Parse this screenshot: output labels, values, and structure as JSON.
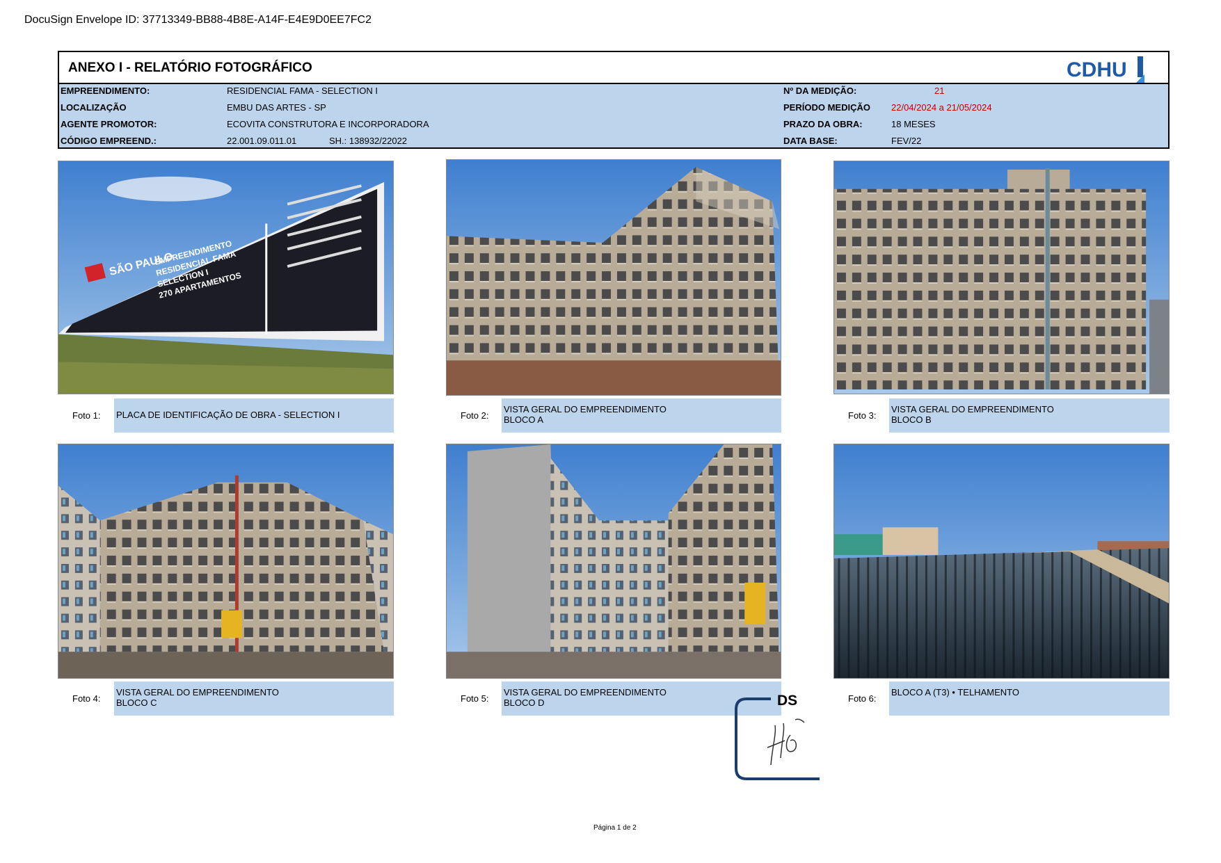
{
  "envelope_id": "DocuSign Envelope ID: 37713349-BB88-4B8E-A14F-E4E9D0EE7FC2",
  "header": {
    "title": "ANEXO I - RELATÓRIO FOTOGRÁFICO",
    "logo_text": "CDHU",
    "left_fields": [
      {
        "label": "EMPREENDIMENTO:",
        "value": "RESIDENCIAL FAMA - SELECTION I"
      },
      {
        "label": "LOCALIZAÇÃO",
        "value": "EMBU DAS ARTES - SP"
      },
      {
        "label": "AGENTE PROMOTOR:",
        "value": "ECOVITA CONSTRUTORA E INCORPORADORA"
      },
      {
        "label": "CÓDIGO EMPREEND.:",
        "value": "22.001.09.011.01",
        "extra": "SH.: 138932/22022"
      }
    ],
    "right_fields": [
      {
        "label": "Nº DA MEDIÇÃO:",
        "value": "21"
      },
      {
        "label": "PERÍODO MEDIÇÃO",
        "value": "22/04/2024 a 21/05/2024"
      },
      {
        "label": "PRAZO DA OBRA:",
        "value": "18 MESES"
      },
      {
        "label": "DATA BASE:",
        "value": "FEV/22"
      }
    ]
  },
  "photos": [
    {
      "number": "Foto 1:",
      "line1": "PLACA DE IDENTIFICAÇÃO DE OBRA - SELECTION I",
      "line2": ""
    },
    {
      "number": "Foto 2:",
      "line1": "VISTA GERAL DO EMPREENDIMENTO",
      "line2": "BLOCO A"
    },
    {
      "number": "Foto 3:",
      "line1": "VISTA GERAL DO EMPREENDIMENTO",
      "line2": "BLOCO B"
    },
    {
      "number": "Foto 4:",
      "line1": "VISTA GERAL DO EMPREENDIMENTO",
      "line2": "BLOCO C"
    },
    {
      "number": "Foto 5:",
      "line1": "VISTA GERAL DO EMPREENDIMENTO",
      "line2": "BLOCO D"
    },
    {
      "number": "Foto 6:",
      "line1": "BLOCO A (T3) •  TELHAMENTO",
      "line2": ""
    }
  ],
  "sign_board": {
    "brand": "SÃO PAULO",
    "line1": "EMPREENDIMENTO",
    "line2": "RESIDENCIAL FAMA",
    "line3": "SELECTION I",
    "line4": "270 APARTAMENTOS"
  },
  "ds_label": "DS",
  "page_number": "Página 1 de 2",
  "colors": {
    "table_fill": "#bcd5ec",
    "highlight_red": "#c00000",
    "logo_blue": "#1f5aa6"
  }
}
